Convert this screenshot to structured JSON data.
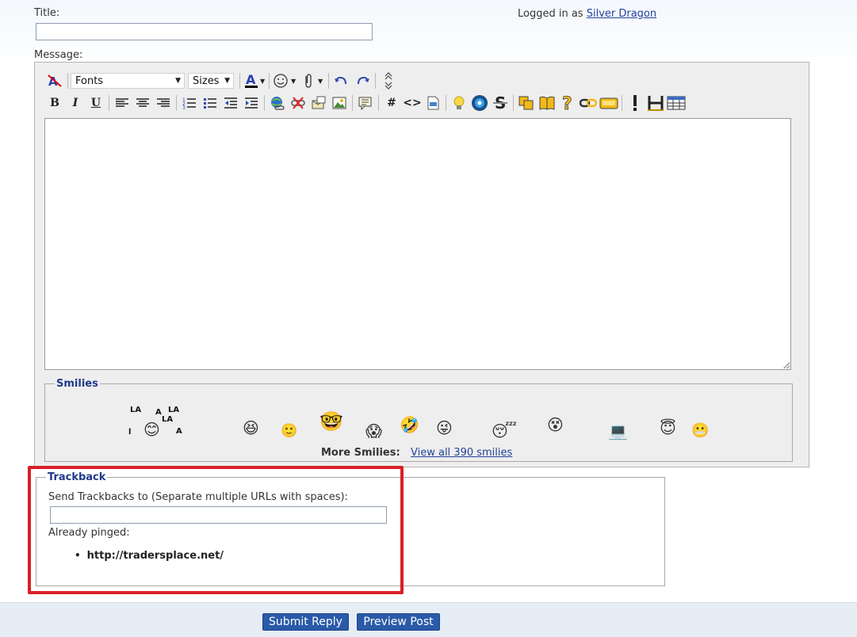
{
  "form": {
    "title_label": "Title:",
    "title_value": "",
    "logged_in_prefix": "Logged in as",
    "username": "Silver Dragon",
    "message_label": "Message:"
  },
  "toolbar": {
    "fonts_label": "Fonts",
    "sizes_label": "Sizes",
    "icons_row1": [
      "remove-format-icon",
      "fonts-select",
      "sizes-select",
      "text-color-icon",
      "smiley-icon",
      "attachment-icon",
      "undo-icon",
      "redo-icon",
      "resize-icon"
    ],
    "bold": "B",
    "italic": "I",
    "underline": "U",
    "hash": "#",
    "code": "<>"
  },
  "smilies": {
    "legend": "Smilies",
    "lala": [
      "LA",
      "LA",
      "LA",
      "LA",
      "A",
      "A",
      "l"
    ],
    "more_label": "More Smilies:",
    "view_all_link": "View all 390 smilies"
  },
  "trackback": {
    "legend": "Trackback",
    "send_label": "Send Trackbacks to (Separate multiple URLs with spaces):",
    "send_value": "",
    "already_pinged_label": "Already pinged:",
    "pinged": [
      "http://tradersplace.net/"
    ]
  },
  "buttons": {
    "submit": "Submit Reply",
    "preview": "Preview Post"
  },
  "colors": {
    "link": "#22429a",
    "legend": "#1f3a8a",
    "button": "#2a5aa8",
    "highlight": "#d91f26"
  }
}
